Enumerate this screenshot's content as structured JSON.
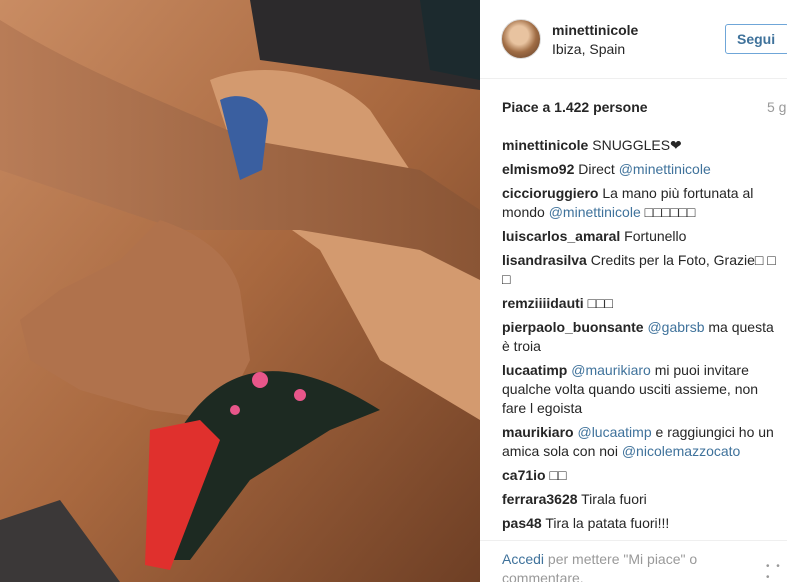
{
  "post": {
    "username": "minettinicole",
    "location": "Ibiza, Spain",
    "follow_label": "Segui",
    "likes_text": "Piace a 1.422 persone",
    "time_ago": "5 g"
  },
  "comments": [
    {
      "user": "minettinicole",
      "parts": [
        {
          "t": " SNUGGLES❤"
        }
      ]
    },
    {
      "user": "elmismo92",
      "parts": [
        {
          "t": " Direct "
        },
        {
          "t": "@minettinicole",
          "mention": true
        }
      ]
    },
    {
      "user": "ciccioruggiero",
      "parts": [
        {
          "t": " La mano più fortunata al mondo "
        },
        {
          "t": "@minettinicole",
          "mention": true
        },
        {
          "t": " □□□□□□"
        }
      ]
    },
    {
      "user": "luiscarlos_amaral",
      "parts": [
        {
          "t": " Fortunello"
        }
      ]
    },
    {
      "user": "lisandrasilva",
      "parts": [
        {
          "t": " Credits per la Foto, Grazie□ □ □"
        }
      ]
    },
    {
      "user": "remziiiidauti",
      "parts": [
        {
          "t": " □□□"
        }
      ]
    },
    {
      "user": "pierpaolo_buonsante",
      "parts": [
        {
          "t": " "
        },
        {
          "t": "@gabrsb",
          "mention": true
        },
        {
          "t": " ma questa è troia"
        }
      ]
    },
    {
      "user": "lucaatimp",
      "parts": [
        {
          "t": " "
        },
        {
          "t": "@maurikiaro",
          "mention": true
        },
        {
          "t": " mi puoi invitare qualche volta quando usciti assieme, non fare l egoista"
        }
      ]
    },
    {
      "user": "maurikiaro",
      "parts": [
        {
          "t": " "
        },
        {
          "t": "@lucaatimp",
          "mention": true
        },
        {
          "t": " e raggiungici ho un amica sola con noi "
        },
        {
          "t": "@nicolemazzocato",
          "mention": true
        }
      ]
    },
    {
      "user": "ca71io",
      "parts": [
        {
          "t": " □□"
        }
      ]
    },
    {
      "user": "ferrara3628",
      "parts": [
        {
          "t": " Tirala fuori"
        }
      ]
    },
    {
      "user": "pas48",
      "parts": [
        {
          "t": " Tira la patata fuori!!!"
        }
      ]
    }
  ],
  "footer": {
    "login_link": "Accedi",
    "login_rest": " per mettere \"Mi piace\" o commentare.",
    "more_icon": "more-dots-icon"
  },
  "colors": {
    "link": "#3f729b",
    "text": "#262626",
    "muted": "#999999",
    "follow_border": "#6fa6d8"
  }
}
